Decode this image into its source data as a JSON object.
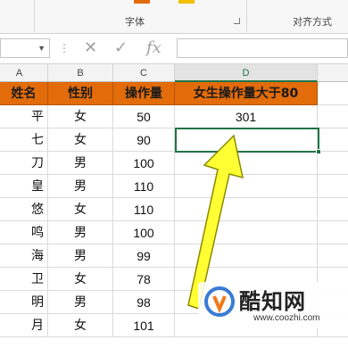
{
  "ribbon": {
    "font_group_label": "字体",
    "align_group_label": "对齐方式"
  },
  "formula_bar": {
    "cancel_icon": "cancel-x-icon",
    "enter_icon": "check-icon",
    "fx_label": "fx",
    "formula_value": ""
  },
  "columns": [
    "A",
    "B",
    "C",
    "D"
  ],
  "selected_column": "D",
  "table": {
    "headers": [
      "姓名",
      "性别",
      "操作量",
      "女生操作量大于80"
    ],
    "rows": [
      {
        "name": "平",
        "gender": "女",
        "ops": "50",
        "result": "301"
      },
      {
        "name": "七",
        "gender": "女",
        "ops": "90",
        "result": ""
      },
      {
        "name": "刀",
        "gender": "男",
        "ops": "100",
        "result": ""
      },
      {
        "name": "皇",
        "gender": "男",
        "ops": "110",
        "result": ""
      },
      {
        "name": "悠",
        "gender": "女",
        "ops": "110",
        "result": ""
      },
      {
        "name": "鸣",
        "gender": "男",
        "ops": "100",
        "result": ""
      },
      {
        "name": "海",
        "gender": "男",
        "ops": "99",
        "result": ""
      },
      {
        "name": "卫",
        "gender": "女",
        "ops": "78",
        "result": ""
      },
      {
        "name": "明",
        "gender": "男",
        "ops": "98",
        "result": ""
      },
      {
        "name": "月",
        "gender": "女",
        "ops": "101",
        "result": ""
      }
    ]
  },
  "annotation_arrow_color": "#ffff33",
  "header_fill_color": "#e26b0a",
  "watermark": {
    "brand": "酷知网",
    "url": "www.coozhi.com"
  }
}
